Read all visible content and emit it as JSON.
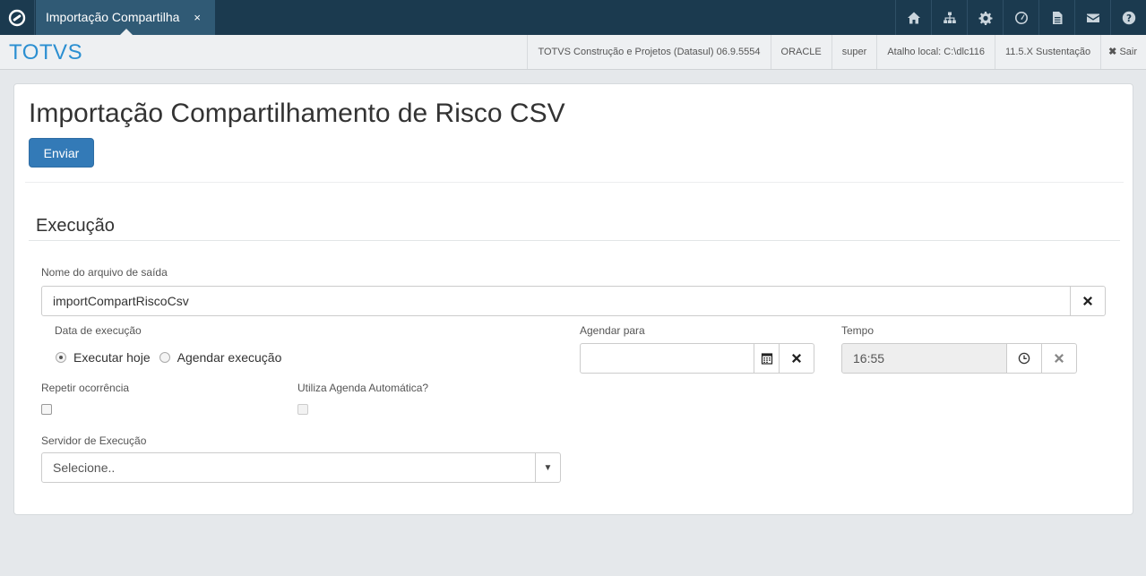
{
  "tab": {
    "label": "Importação Compartilhamento de Risco CSV",
    "close": "×"
  },
  "top_icons": [
    "home-icon",
    "sitemap-icon",
    "gear-icon",
    "dashboard-icon",
    "document-icon",
    "mail-icon",
    "help-icon"
  ],
  "header": {
    "brand": "TOTVS",
    "product": "TOTVS Construção e Projetos (Datasul) 06.9.5554",
    "database": "ORACLE",
    "user": "super",
    "shortcut": "Atalho local: C:\\dlc116",
    "version": "11.5.X Sustentação",
    "exit": "Sair"
  },
  "page": {
    "title": "Importação Compartilhamento de Risco CSV",
    "send_label": "Enviar"
  },
  "execution": {
    "section_title": "Execução",
    "output_file_label": "Nome do arquivo de saída",
    "output_file_value": "importCompartRiscoCsv",
    "exec_date_label": "Data de execução",
    "run_today_label": "Executar hoje",
    "schedule_label": "Agendar execução",
    "schedule_for_label": "Agendar para",
    "schedule_for_value": "",
    "time_label": "Tempo",
    "time_value": "16:55",
    "repeat_label": "Repetir ocorrência",
    "auto_schedule_label": "Utiliza Agenda Automática?",
    "server_label": "Servidor de Execução",
    "server_value": "Selecione.."
  },
  "colors": {
    "topbar": "#1b3a4f",
    "tab": "#305a75",
    "brand": "#2b8fd1",
    "primary": "#337ab7"
  }
}
